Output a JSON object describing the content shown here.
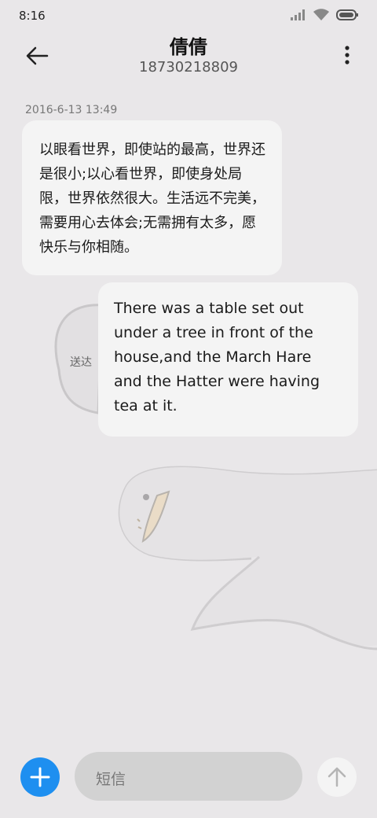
{
  "status_bar": {
    "time": "8:16",
    "icons": [
      "cellular-signal-icon",
      "wifi-icon",
      "battery-icon"
    ]
  },
  "header": {
    "contact_name": "倩倩",
    "phone_number": "18730218809",
    "back_icon": "arrow-left-icon",
    "menu_icon": "more-vertical-icon"
  },
  "conversation": {
    "timestamp": "2016-6-13 13:49",
    "incoming_message": "以眼看世界，即使站的最高，世界还是很小;以心看世界，即使身处局限，世界依然很大。生活远不完美，需要用心去体会;无需拥有太多，愿快乐与你相随。",
    "outgoing_message": "There was a table set out under a tree in front of the house,and the March Hare and the Hatter were having tea at it.",
    "delivery_status": "送达"
  },
  "composer": {
    "placeholder": "短信",
    "add_icon": "plus-icon",
    "send_icon": "arrow-up-icon"
  },
  "colors": {
    "background": "#e9e7e9",
    "bubble": "#f4f4f4",
    "accent": "#1e8ff0",
    "input": "#d2d2d2"
  }
}
